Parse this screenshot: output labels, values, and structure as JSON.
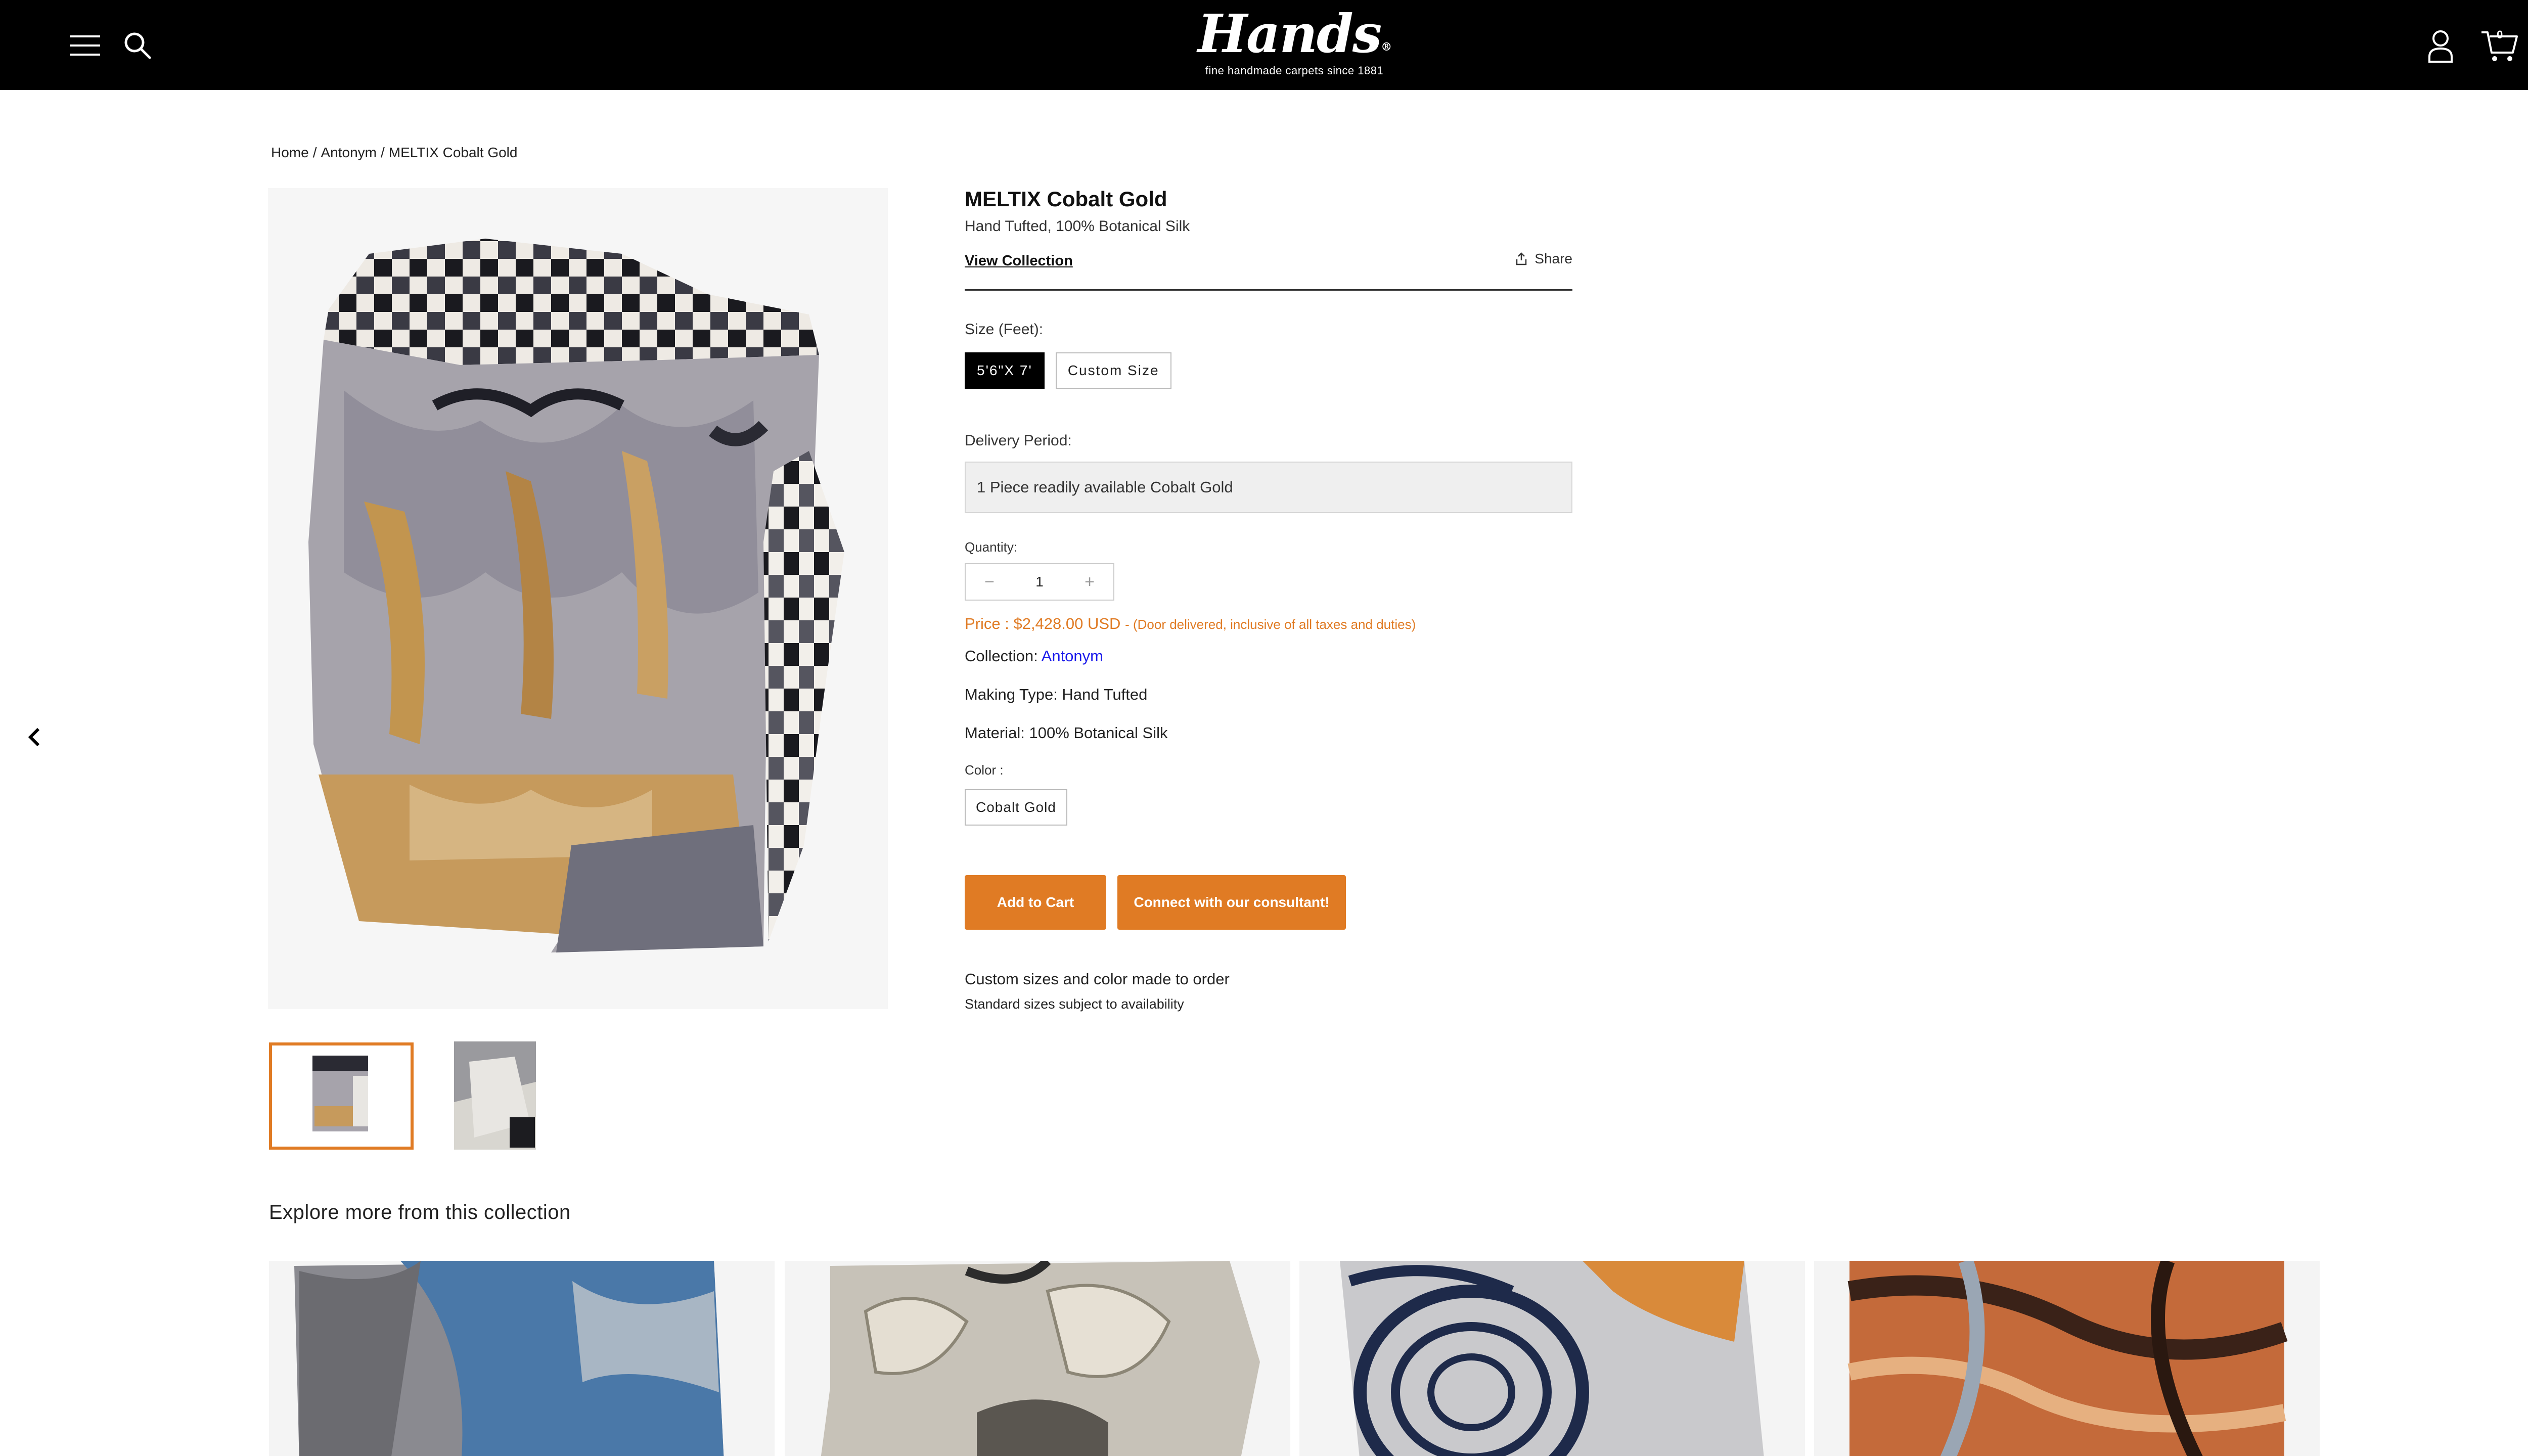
{
  "header": {
    "brand": "Hands",
    "brand_mark": "®",
    "tagline": "fine handmade carpets since 1881",
    "cart_count": "0",
    "icons": [
      "menu-icon",
      "search-icon",
      "account-icon",
      "cart-icon"
    ]
  },
  "breadcrumb": {
    "items": [
      "Home",
      "Antonym",
      "MELTIX Cobalt Gold"
    ],
    "separator": "/"
  },
  "product": {
    "title": "MELTIX Cobalt Gold",
    "subtitle": "Hand Tufted, 100% Botanical Silk",
    "view_collection": "View Collection",
    "share": "Share",
    "size_label": "Size (Feet):",
    "sizes": [
      "5'6\"X 7'",
      "Custom Size"
    ],
    "selected_size": "5'6\"X 7'",
    "delivery_label": "Delivery Period:",
    "delivery_value": "1 Piece readily available Cobalt Gold",
    "quantity_label": "Quantity:",
    "quantity_value": "1",
    "qty_minus": "−",
    "qty_plus": "+",
    "price": "Price : $2,428.00 USD",
    "price_note": "- (Door delivered, inclusive of all taxes and duties)",
    "collection_label": "Collection:",
    "collection_value": "Antonym",
    "making_type": "Making Type: Hand Tufted",
    "material": "Material: 100% Botanical Silk",
    "color_label": "Color :",
    "color_value": "Cobalt Gold",
    "add_to_cart": "Add to Cart",
    "connect": "Connect with our consultant!",
    "custom_note": "Custom sizes and color made to order",
    "standard_note": "Standard sizes subject to availability"
  },
  "explore": {
    "title": "Explore more from this collection"
  },
  "colors": {
    "accent": "#e07b24",
    "header_bg": "#000000",
    "link_blue": "#1a1aeb"
  }
}
